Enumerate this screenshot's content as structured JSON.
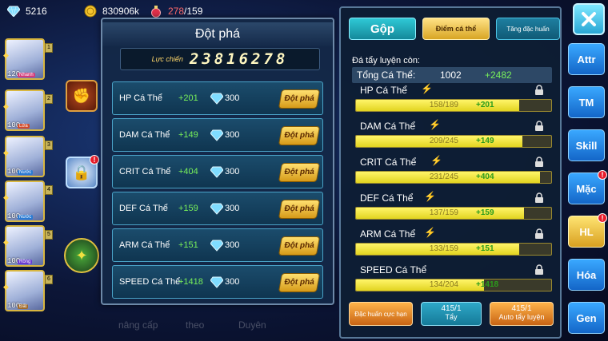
{
  "topbar": {
    "gems": "5216",
    "gold": "830906k",
    "stamina_current": "278",
    "stamina_sep": "/",
    "stamina_max": "159"
  },
  "heroes": [
    {
      "level": "120",
      "tag": "Nhanh",
      "tag_color": "#d23c7a"
    },
    {
      "level": "100",
      "tag": "Lửa",
      "tag_color": "#d24a2a"
    },
    {
      "level": "100",
      "tag": "Nước",
      "tag_color": "#2a7ad2"
    },
    {
      "level": "100",
      "tag": "Nước",
      "tag_color": "#2a7ad2"
    },
    {
      "level": "100",
      "tag": "Rồng",
      "tag_color": "#6a3ad2"
    },
    {
      "level": "100",
      "tag": "Đất",
      "tag_color": "#a06a2a"
    }
  ],
  "breakthrough": {
    "title": "Đột phá",
    "power_label": "Lực chiến",
    "power_value": "23816278",
    "button_label": "Đột phá",
    "rows": [
      {
        "name": "HP Cá Thể",
        "inc": "+201",
        "cost": "300"
      },
      {
        "name": "DAM Cá Thể",
        "inc": "+149",
        "cost": "300"
      },
      {
        "name": "CRIT Cá Thể",
        "inc": "+404",
        "cost": "300"
      },
      {
        "name": "DEF Cá Thể",
        "inc": "+159",
        "cost": "300"
      },
      {
        "name": "ARM Cá Thể",
        "inc": "+151",
        "cost": "300"
      },
      {
        "name": "SPEED Cá Thể",
        "inc": "+1418",
        "cost": "300"
      }
    ]
  },
  "stats_panel": {
    "tabs": {
      "gop": "Gộp",
      "diem": "Điểm cá thể",
      "tang": "Tăng đặc huấn"
    },
    "remaining_label": "Đá tẩy luyện còn:",
    "total_label": "Tổng Cá Thể:",
    "total_value": "1002",
    "total_add": "+2482",
    "stats": [
      {
        "name": "HP Cá Thể",
        "current": "158/189",
        "plus": "+201",
        "fill": 0.836
      },
      {
        "name": "DAM Cá Thể",
        "current": "209/245",
        "plus": "+149",
        "fill": 0.853
      },
      {
        "name": "CRIT Cá Thể",
        "current": "231/245",
        "plus": "+404",
        "fill": 0.943
      },
      {
        "name": "DEF Cá Thể",
        "current": "137/159",
        "plus": "+159",
        "fill": 0.862
      },
      {
        "name": "ARM Cá Thể",
        "current": "133/159",
        "plus": "+151",
        "fill": 0.836
      },
      {
        "name": "SPEED Cá Thể",
        "current": "134/204",
        "plus": "+1418",
        "fill": 0.657
      }
    ],
    "btn_dac_huan": "Đặc huấn cực hạn",
    "btn_tay_count": "415/1",
    "btn_tay_label": "Tẩy",
    "btn_auto_count": "415/1",
    "btn_auto_label": "Auto tẩy luyện"
  },
  "nav": {
    "attr": "Attr",
    "tm": "TM",
    "skill": "Skill",
    "mac": "Mặc",
    "hl": "HL",
    "hoa": "Hóa",
    "gen": "Gen",
    "badge": "!"
  },
  "background": {
    "t1": "nâng cấp",
    "t2": "theo",
    "t3": "Duyên"
  },
  "colors": {
    "accent_green": "#78ef5a",
    "gold": "#ffd54a",
    "panel_border": "#4aa3c8"
  }
}
